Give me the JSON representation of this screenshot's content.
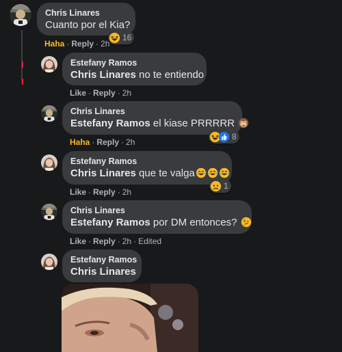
{
  "comments": [
    {
      "author": "Chris Linares",
      "text": "Cuanto por el Kia?",
      "reaction_count": "16",
      "actions": {
        "reaction_label": "Haha",
        "reply_label": "Reply",
        "time": "2h"
      }
    },
    {
      "author": "Estefany Ramos",
      "mention": "Chris Linares",
      "text": " no te entiendo",
      "actions": {
        "like_label": "Like",
        "reply_label": "Reply",
        "time": "2h"
      }
    },
    {
      "author": "Chris Linares",
      "mention": "Estefany Ramos",
      "text": " el kiase PRRRRR",
      "reaction_count": "8",
      "actions": {
        "reaction_label": "Haha",
        "reply_label": "Reply",
        "time": "2h"
      }
    },
    {
      "author": "Estefany Ramos",
      "mention": "Chris Linares",
      "text": " que te valga",
      "reaction_count": "1",
      "actions": {
        "like_label": "Like",
        "reply_label": "Reply",
        "time": "2h"
      }
    },
    {
      "author": "Chris Linares",
      "mention": "Estefany Ramos",
      "text": " por DM entonces?",
      "actions": {
        "like_label": "Like",
        "reply_label": "Reply",
        "time": "2h",
        "edited_label": "Edited"
      }
    },
    {
      "author": "Estefany Ramos",
      "mention": "Chris Linares"
    }
  ],
  "separator": "·",
  "colors": {
    "background": "#18191a",
    "bubble": "#3a3b3c",
    "text": "#e4e6eb",
    "secondary": "#b0b3b8",
    "haha": "#f7b928",
    "like_blue": "#1877f2"
  },
  "icons": {
    "haha": "laughing-face-icon",
    "like": "thumbs-up-icon",
    "sad": "sad-face-icon",
    "monkey": "see-no-evil-monkey-emoji",
    "tears": "tears-of-joy-emoji",
    "thinking": "thinking-face-emoji"
  }
}
